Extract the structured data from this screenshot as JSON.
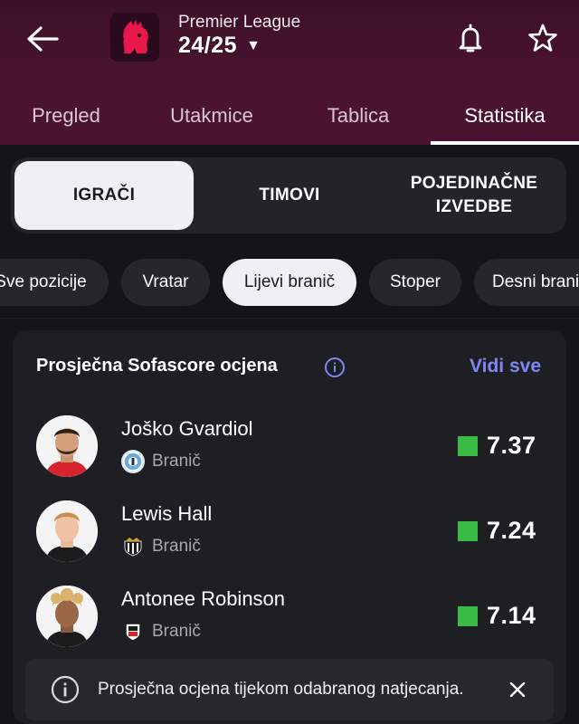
{
  "header": {
    "league_name": "Premier League",
    "season": "24/25",
    "icons": {
      "back": "arrow-left-icon",
      "bell": "bell-icon",
      "star": "star-icon",
      "caret": "caret-down-icon",
      "logo": "premier-league-lion-logo"
    },
    "accent": "#4a1430"
  },
  "tabs": [
    {
      "label": "Pregled"
    },
    {
      "label": "Utakmice"
    },
    {
      "label": "Tablica"
    },
    {
      "label": "Statistika",
      "active": true
    }
  ],
  "segments": [
    {
      "label": "IGRAČI",
      "active": true
    },
    {
      "label": "TIMOVI"
    },
    {
      "label": "POJEDINAČNE IZVEDBE"
    }
  ],
  "position_filters": [
    {
      "label": "Sve pozicije"
    },
    {
      "label": "Vratar"
    },
    {
      "label": "Lijevi branič",
      "active": true
    },
    {
      "label": "Stoper"
    },
    {
      "label": "Desni branič"
    }
  ],
  "card": {
    "title": "Prosječna Sofascore ocjena",
    "see_all": "Vidi sve",
    "players": [
      {
        "name": "Joško Gvardiol",
        "position": "Branič",
        "rating": "7.37",
        "club_icon": "manchester-city-crest"
      },
      {
        "name": "Lewis Hall",
        "position": "Branič",
        "rating": "7.24",
        "club_icon": "newcastle-crest"
      },
      {
        "name": "Antonee Robinson",
        "position": "Branič",
        "rating": "7.14",
        "club_icon": "fulham-crest"
      }
    ],
    "rating_color": "#3cba46",
    "link_color": "#7f86f5"
  },
  "toast": {
    "text": "Prosječna ocjena tijekom odabranog natjecanja."
  }
}
